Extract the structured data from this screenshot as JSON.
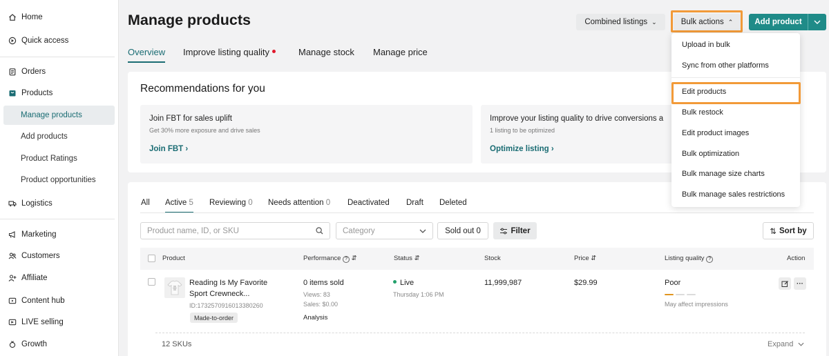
{
  "sidebar": {
    "items": [
      {
        "label": "Home",
        "icon": "home-icon"
      },
      {
        "label": "Quick access",
        "icon": "quick-access-icon"
      },
      {
        "label": "Orders",
        "icon": "clipboard-icon"
      },
      {
        "label": "Products",
        "icon": "products-icon"
      },
      {
        "label": "Manage products"
      },
      {
        "label": "Add products"
      },
      {
        "label": "Product Ratings"
      },
      {
        "label": "Product opportunities"
      },
      {
        "label": "Logistics",
        "icon": "truck-icon"
      },
      {
        "label": "Marketing",
        "icon": "megaphone-icon"
      },
      {
        "label": "Customers",
        "icon": "customers-icon"
      },
      {
        "label": "Affiliate",
        "icon": "affiliate-icon"
      },
      {
        "label": "Content hub",
        "icon": "content-hub-icon"
      },
      {
        "label": "LIVE selling",
        "icon": "live-icon"
      },
      {
        "label": "Growth",
        "icon": "growth-icon"
      }
    ]
  },
  "header": {
    "title": "Manage products",
    "combined_listings": "Combined listings",
    "bulk_actions": "Bulk actions",
    "add_product": "Add product"
  },
  "top_tabs": [
    {
      "label": "Overview"
    },
    {
      "label": "Improve listing quality"
    },
    {
      "label": "Manage stock"
    },
    {
      "label": "Manage price"
    }
  ],
  "recommendations": {
    "title": "Recommendations for you",
    "cards": [
      {
        "heading": "Join FBT for sales uplift",
        "sub": "Get 30% more exposure and drive sales",
        "link": "Join FBT"
      },
      {
        "heading": "Improve your listing quality to drive conversions a",
        "sub": "1 listing to be optimized",
        "link": "Optimize listing"
      }
    ]
  },
  "list_tabs": [
    {
      "label": "All",
      "count": ""
    },
    {
      "label": "Active",
      "count": "5"
    },
    {
      "label": "Reviewing",
      "count": "0"
    },
    {
      "label": "Needs attention",
      "count": "0"
    },
    {
      "label": "Deactivated",
      "count": ""
    },
    {
      "label": "Draft",
      "count": ""
    },
    {
      "label": "Deleted",
      "count": ""
    }
  ],
  "filters": {
    "search_placeholder": "Product name, ID, or SKU",
    "category_placeholder": "Category",
    "sold_out": "Sold out 0",
    "filter": "Filter",
    "sort_by": "Sort by"
  },
  "table": {
    "columns": [
      "Product",
      "Performance",
      "Status",
      "Stock",
      "Price",
      "Listing quality",
      "Action"
    ],
    "row": {
      "name_line1": "Reading Is My Favorite",
      "name_line2": "Sport Crewneck...",
      "id": "ID:1732570916013380260",
      "badge": "Made-to-order",
      "items_sold": "0 items sold",
      "views": "Views: 83",
      "sales": "Sales: $0.00",
      "analysis": "Analysis",
      "status": "Live",
      "status_time": "Thursday 1:06 PM",
      "stock": "11,999,987",
      "price": "$29.99",
      "quality": "Poor",
      "quality_note": "May affect impressions"
    },
    "skus": "12 SKUs",
    "expand": "Expand"
  },
  "bulk_menu": {
    "items": [
      "Upload in bulk",
      "Sync from other platforms",
      "Edit products",
      "Bulk restock",
      "Edit product images",
      "Bulk optimization",
      "Bulk manage size charts",
      "Bulk manage sales restrictions"
    ]
  },
  "colors": {
    "accent": "#1a6c73",
    "primary_button": "#1f8b88",
    "highlight": "#f29a38",
    "alert_dot": "#e0182b",
    "live": "#22a06b",
    "quality_bar": "#e0951f"
  }
}
